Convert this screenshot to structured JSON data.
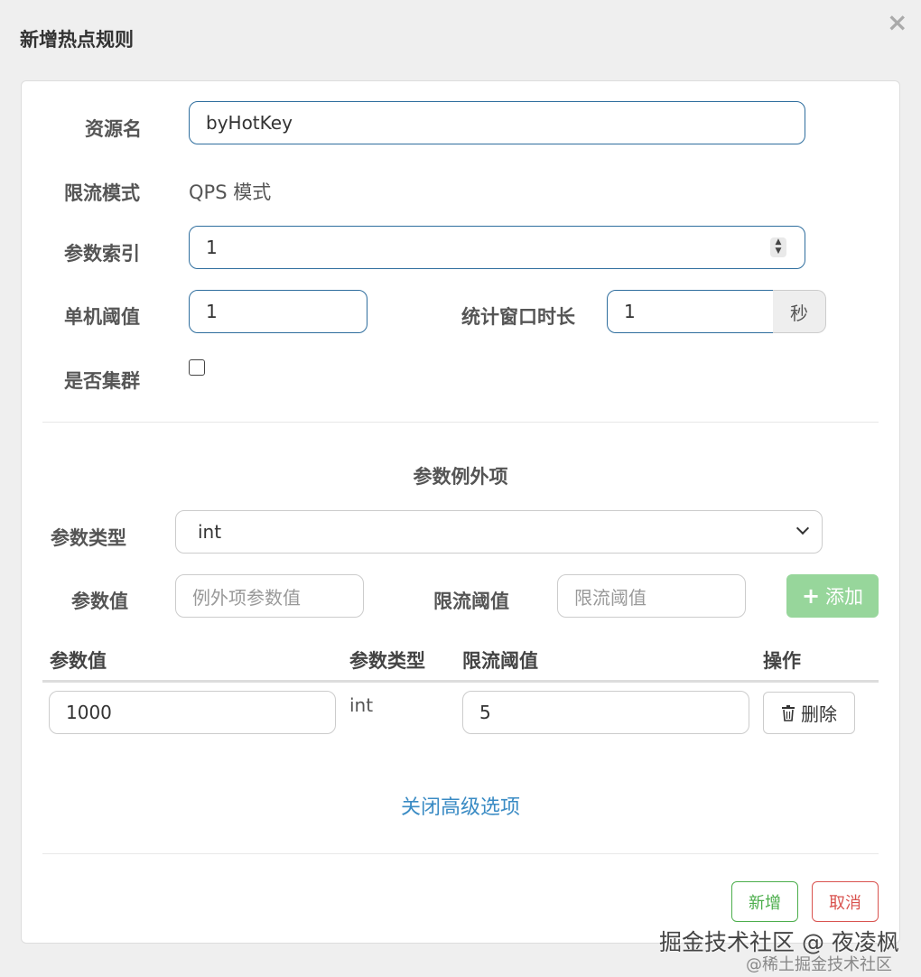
{
  "dialog": {
    "title": "新增热点规则",
    "close_label": "×"
  },
  "form": {
    "resource_label": "资源名",
    "resource_value": "byHotKey",
    "mode_label": "限流模式",
    "mode_value": "QPS 模式",
    "param_index_label": "参数索引",
    "param_index_value": "1",
    "threshold_label": "单机阈值",
    "threshold_value": "1",
    "window_label": "统计窗口时长",
    "window_value": "1",
    "window_unit": "秒",
    "cluster_label": "是否集群",
    "cluster_checked": false
  },
  "exceptions": {
    "section_title": "参数例外项",
    "type_label": "参数类型",
    "type_value": "int",
    "value_label": "参数值",
    "value_placeholder": "例外项参数值",
    "limit_label": "限流阈值",
    "limit_placeholder": "限流阈值",
    "add_button": "添加",
    "table": {
      "headers": [
        "参数值",
        "参数类型",
        "限流阈值",
        "操作"
      ],
      "rows": [
        {
          "value": "1000",
          "type": "int",
          "limit": "5",
          "action": "删除"
        }
      ]
    }
  },
  "advanced_link": "关闭高级选项",
  "footer": {
    "save_button": "新增",
    "cancel_button": "取消"
  },
  "watermark": {
    "line1": "掘金技术社区 @ 夜凌枫",
    "line2": "@稀土掘金技术社区"
  },
  "colors": {
    "add_button_bg": "#97d69b",
    "save_color": "#4cae4c",
    "cancel_color": "#d9534f",
    "link_color": "#3a8bc4",
    "focus_border": "#2f6e9e"
  }
}
